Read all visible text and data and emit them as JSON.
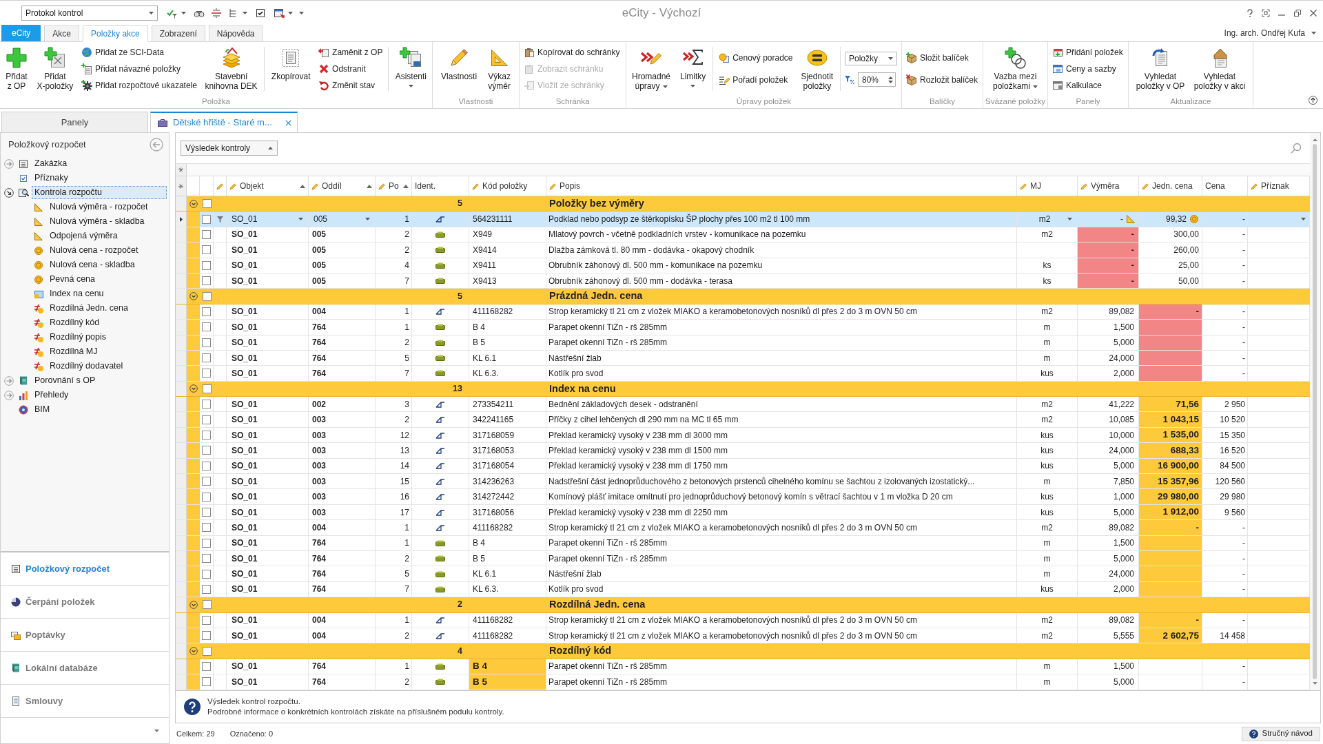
{
  "window": {
    "title": "eCity - Výchozí",
    "user": "Ing. arch. Ondřej Kufa"
  },
  "quick_access": {
    "combo": "Protokol kontrol"
  },
  "ribbon_tabs": [
    {
      "label": "eCity",
      "kind": "app",
      "selected": false
    },
    {
      "label": "Akce",
      "kind": "tab",
      "selected": false
    },
    {
      "label": "Položky akce",
      "kind": "tab",
      "selected": true
    },
    {
      "label": "Zobrazení",
      "kind": "tab",
      "selected": false
    },
    {
      "label": "Nápověda",
      "kind": "tab",
      "selected": false
    }
  ],
  "ribbon_groups": [
    {
      "label": "Položka",
      "items": [
        {
          "kind": "large",
          "label": "Přidat\nz OP",
          "dropdown": false
        },
        {
          "kind": "large",
          "label": "Přidat\nX-položky",
          "dropdown": false
        },
        {
          "kind": "stack",
          "items": [
            {
              "label": "Přidat ze SCI-Data"
            },
            {
              "label": "Přidat návazné položky"
            },
            {
              "label": "Přidat rozpočtové ukazatele"
            }
          ]
        },
        {
          "kind": "large",
          "label": "Stavební\nknihovna DEK",
          "dropdown": false
        },
        {
          "kind": "separator"
        },
        {
          "kind": "large",
          "label": "Zkopírovat",
          "dropdown": false
        },
        {
          "kind": "stack",
          "items": [
            {
              "label": "Zaměnit z OP"
            },
            {
              "label": "Odstranit"
            },
            {
              "label": "Změnit stav"
            }
          ]
        },
        {
          "kind": "separator"
        },
        {
          "kind": "large",
          "label": "Asistenti",
          "dropdown": true
        }
      ]
    },
    {
      "label": "Vlastnosti",
      "items": [
        {
          "kind": "large",
          "label": "Vlastnosti",
          "dropdown": false
        },
        {
          "kind": "large",
          "label": "Výkaz\nvýměr",
          "dropdown": false
        }
      ]
    },
    {
      "label": "Schránka",
      "items": [
        {
          "kind": "stack",
          "items": [
            {
              "label": "Kopírovat do schránky",
              "disabled": false
            },
            {
              "label": "Zobrazit schránku",
              "disabled": true
            },
            {
              "label": "Vložit ze schránky",
              "disabled": true
            }
          ]
        }
      ]
    },
    {
      "label": "Úpravy položek",
      "items": [
        {
          "kind": "large",
          "label": "Hromadné\núpravy",
          "dropdown": true
        },
        {
          "kind": "large",
          "label": "Limitky",
          "dropdown": true
        },
        {
          "kind": "separator"
        },
        {
          "kind": "stack",
          "items": [
            {
              "label": "Cenový poradce"
            },
            {
              "label": "Pořadí položek"
            }
          ]
        },
        {
          "kind": "large",
          "label": "Sjednotit\npoložky",
          "dropdown": false
        },
        {
          "kind": "separator"
        },
        {
          "kind": "controls",
          "select": "Položky",
          "zoom": "80%"
        }
      ]
    },
    {
      "label": "Balíčky",
      "items": [
        {
          "kind": "stack",
          "items": [
            {
              "label": "Složit balíček"
            },
            {
              "label": "Rozložit balíček"
            }
          ]
        }
      ]
    },
    {
      "label": "Svázané položky",
      "items": [
        {
          "kind": "large",
          "label": "Vazba mezi\npoložkami",
          "dropdown": true
        }
      ]
    },
    {
      "label": "Panely",
      "items": [
        {
          "kind": "stack",
          "items": [
            {
              "label": "Přidání položek"
            },
            {
              "label": "Ceny a sazby"
            },
            {
              "label": "Kalkulace"
            }
          ]
        }
      ]
    },
    {
      "label": "Aktualizace",
      "items": [
        {
          "kind": "large",
          "label": "Vyhledat\npoložky v OP",
          "dropdown": false
        },
        {
          "kind": "large",
          "label": "Vyhledat\npoložky v akci",
          "dropdown": false
        }
      ]
    }
  ],
  "panel_header": "Panely",
  "document_tabs": [
    {
      "label": "Dětské hřiště - Staré m...",
      "selected": true
    }
  ],
  "left_panel": {
    "title": "Položkový rozpočet",
    "tree": [
      {
        "label": "Zakázka",
        "expanded": false,
        "selected": false
      },
      {
        "label": "Příznaky",
        "selected": false
      },
      {
        "label": "Kontrola rozpočtu",
        "expanded": true,
        "selected": true,
        "children": [
          {
            "label": "Nulová výměra - rozpočet",
            "selected": false
          },
          {
            "label": "Nulová výměra - skladba",
            "selected": false
          },
          {
            "label": "Odpojená výměra",
            "selected": false
          },
          {
            "label": "Nulová cena - rozpočet",
            "selected": false
          },
          {
            "label": "Nulová cena - skladba",
            "selected": false
          },
          {
            "label": "Pevná cena",
            "selected": false
          },
          {
            "label": "Index na cenu",
            "selected": false
          },
          {
            "label": "Rozdílná Jedn. cena",
            "selected": false
          },
          {
            "label": "Rozdílný kód",
            "selected": false
          },
          {
            "label": "Rozdílný popis",
            "selected": false
          },
          {
            "label": "Rozdílná MJ",
            "selected": false
          },
          {
            "label": "Rozdílný dodavatel",
            "selected": false
          }
        ]
      },
      {
        "label": "Porovnání s OP",
        "expanded": false,
        "selected": false
      },
      {
        "label": "Přehledy",
        "expanded": false,
        "selected": false
      },
      {
        "label": "BIM",
        "selected": false
      }
    ],
    "nav": [
      {
        "label": "Položkový rozpočet",
        "selected": true
      },
      {
        "label": "Čerpání položek",
        "selected": false
      },
      {
        "label": "Poptávky",
        "selected": false
      },
      {
        "label": "Lokální databáze",
        "selected": false
      },
      {
        "label": "Smlouvy",
        "selected": false
      }
    ]
  },
  "grid": {
    "result_select": "Výsledek kontroly",
    "columns": [
      {
        "editable": true,
        "sorted": false
      },
      {
        "label": "Objekt",
        "editable": true,
        "sorted": true
      },
      {
        "label": "Oddíl",
        "editable": true,
        "sorted": true
      },
      {
        "label": "Po",
        "editable": true,
        "sorted": true
      },
      {
        "label": "Ident.",
        "editable": false,
        "sorted": false
      },
      {
        "label": "Kód položky",
        "editable": true,
        "sorted": false
      },
      {
        "label": "Popis",
        "editable": true,
        "sorted": false
      },
      {
        "label": "MJ",
        "editable": true,
        "sorted": false
      },
      {
        "label": "Výměra",
        "editable": true,
        "sorted": false
      },
      {
        "label": "Jedn. cena",
        "editable": true,
        "sorted": false
      },
      {
        "label": "Cena",
        "editable": false,
        "sorted": false
      },
      {
        "label": "Příznak",
        "editable": true,
        "sorted": false
      }
    ],
    "groups": [
      {
        "title": "Položky bez výměry",
        "count": "5",
        "color": "#f28585",
        "kind": "quantity",
        "expanded": true,
        "checked": false,
        "rows": [
          {
            "object": "SO_01",
            "section": "005",
            "order": "1",
            "kind": "work",
            "code": "564231111",
            "description": "Podklad nebo podsyp ze štěrkopísku ŠP plochy přes 100 m2 tl 100 mm",
            "unit": "m2",
            "quantity": "-",
            "unit_price": "99,32",
            "price": "-",
            "selected": true,
            "checked": false
          },
          {
            "object": "SO_01",
            "section": "005",
            "order": "2",
            "kind": "material",
            "code": "X949",
            "description": "Mlatový povrch - včetně podkladních vrstev - komunikace na pozemku",
            "unit": "m2",
            "quantity": "-",
            "unit_price": "300,00",
            "price": "-",
            "selected": false,
            "checked": false
          },
          {
            "object": "SO_01",
            "section": "005",
            "order": "2",
            "kind": "material",
            "code": "X9414",
            "description": "Dlažba zámková tl. 80 mm - dodávka - okapový chodník",
            "quantity": "-",
            "unit_price": "260,00",
            "price": "-",
            "selected": false,
            "checked": false
          },
          {
            "object": "SO_01",
            "section": "005",
            "order": "4",
            "kind": "material",
            "code": "X9411",
            "description": "Obrubník záhonový dl. 500 mm - komunikace na pozemku",
            "unit": "ks",
            "quantity": "-",
            "unit_price": "25,00",
            "price": "-",
            "selected": false,
            "checked": false
          },
          {
            "object": "SO_01",
            "section": "005",
            "order": "7",
            "kind": "material",
            "code": "X9413",
            "description": "Obrubník záhonový dl. 500 mm - dodávka - terasa",
            "unit": "ks",
            "quantity": "-",
            "unit_price": "50,00",
            "price": "-",
            "selected": false,
            "checked": false
          }
        ]
      },
      {
        "title": "Prázdná Jedn. cena",
        "count": "5",
        "color": "#f28585",
        "kind": "price",
        "expanded": true,
        "checked": false,
        "rows": [
          {
            "object": "SO_01",
            "section": "004",
            "order": "1",
            "kind": "work",
            "code": "411168282",
            "description": "Strop keramický tl 21 cm z vložek MIAKO a keramobetonových nosníků dl přes 2 do 3 m OVN 50 cm",
            "unit": "m2",
            "quantity": "89,082",
            "unit_price": "-",
            "price": "-",
            "selected": false,
            "checked": false
          },
          {
            "object": "SO_01",
            "section": "764",
            "order": "1",
            "kind": "material",
            "code": "B 4",
            "description": "Parapet okenní TiZn - rš 285mm",
            "unit": "m",
            "quantity": "1,500",
            "price": "-",
            "selected": false,
            "checked": false
          },
          {
            "object": "SO_01",
            "section": "764",
            "order": "2",
            "kind": "material",
            "code": "B 5",
            "description": "Parapet okenní TiZn - rš 285mm",
            "unit": "m",
            "quantity": "5,000",
            "price": "-",
            "selected": false,
            "checked": false
          },
          {
            "object": "SO_01",
            "section": "764",
            "order": "5",
            "kind": "material",
            "code": "KL 6.1",
            "description": "Nástřešní žlab",
            "unit": "m",
            "quantity": "24,000",
            "price": "-",
            "selected": false,
            "checked": false
          },
          {
            "object": "SO_01",
            "section": "764",
            "order": "7",
            "kind": "material",
            "code": "KL 6.3.",
            "description": "Kotlík pro svod",
            "unit": "kus",
            "quantity": "2,000",
            "price": "-",
            "selected": false,
            "checked": false
          }
        ]
      },
      {
        "title": "Index na cenu",
        "count": "13",
        "color": "#ffc93c",
        "kind": "price",
        "expanded": true,
        "checked": false,
        "rows": [
          {
            "object": "SO_01",
            "section": "002",
            "order": "3",
            "kind": "work",
            "code": "273354211",
            "description": "Bednění základových desek - odstranění",
            "unit": "m2",
            "quantity": "41,222",
            "unit_price": "71,56",
            "price": "2 950",
            "selected": false,
            "checked": false
          },
          {
            "object": "SO_01",
            "section": "003",
            "order": "2",
            "kind": "work",
            "code": "342241165",
            "description": "Příčky z cihel lehčených dl 290 mm na MC tl 65 mm",
            "unit": "m2",
            "quantity": "10,085",
            "unit_price": "1 043,15",
            "price": "10 520",
            "selected": false,
            "checked": false
          },
          {
            "object": "SO_01",
            "section": "003",
            "order": "12",
            "kind": "work",
            "code": "317168059",
            "description": "Překlad keramický vysoký v 238 mm dl 3000 mm",
            "unit": "kus",
            "quantity": "10,000",
            "unit_price": "1 535,00",
            "price": "15 350",
            "selected": false,
            "checked": false
          },
          {
            "object": "SO_01",
            "section": "003",
            "order": "13",
            "kind": "work",
            "code": "317168053",
            "description": "Překlad keramický vysoký v 238 mm dl 1500 mm",
            "unit": "kus",
            "quantity": "24,000",
            "unit_price": "688,33",
            "price": "16 520",
            "selected": false,
            "checked": false
          },
          {
            "object": "SO_01",
            "section": "003",
            "order": "14",
            "kind": "work",
            "code": "317168054",
            "description": "Překlad keramický vysoký v 238 mm dl 1750 mm",
            "unit": "kus",
            "quantity": "5,000",
            "unit_price": "16 900,00",
            "price": "84 500",
            "selected": false,
            "checked": false
          },
          {
            "object": "SO_01",
            "section": "003",
            "order": "15",
            "kind": "work",
            "code": "314236263",
            "description": "Nadstřešní část jednoprůduchového z betonových prstenců cihelného komínu se šachtou z izolovaných izostatický...",
            "unit": "m",
            "quantity": "7,850",
            "unit_price": "15 357,96",
            "price": "120 560",
            "selected": false,
            "checked": false
          },
          {
            "object": "SO_01",
            "section": "003",
            "order": "16",
            "kind": "work",
            "code": "314272442",
            "description": "Komínový plášť imitace omítnutí pro jednoprůduchový betonový komín s větrací šachtou v 1 m vložka D 20 cm",
            "unit": "kus",
            "quantity": "1,000",
            "unit_price": "29 980,00",
            "price": "29 980",
            "selected": false,
            "checked": false
          },
          {
            "object": "SO_01",
            "section": "003",
            "order": "17",
            "kind": "work",
            "code": "317168056",
            "description": "Překlad keramický vysoký v 238 mm dl 2250 mm",
            "unit": "kus",
            "quantity": "5,000",
            "unit_price": "1 912,00",
            "price": "9 560",
            "selected": false,
            "checked": false
          },
          {
            "object": "SO_01",
            "section": "004",
            "order": "1",
            "kind": "work",
            "code": "411168282",
            "description": "Strop keramický tl 21 cm z vložek MIAKO a keramobetonových nosníků dl přes 2 do 3 m OVN 50 cm",
            "unit": "m2",
            "quantity": "89,082",
            "unit_price": "-",
            "price": "-",
            "selected": false,
            "checked": false
          },
          {
            "object": "SO_01",
            "section": "764",
            "order": "1",
            "kind": "material",
            "code": "B 4",
            "description": "Parapet okenní TiZn - rš 285mm",
            "unit": "m",
            "quantity": "1,500",
            "price": "-",
            "selected": false,
            "checked": false
          },
          {
            "object": "SO_01",
            "section": "764",
            "order": "2",
            "kind": "material",
            "code": "B 5",
            "description": "Parapet okenní TiZn - rš 285mm",
            "unit": "m",
            "quantity": "5,000",
            "price": "-",
            "selected": false,
            "checked": false
          },
          {
            "object": "SO_01",
            "section": "764",
            "order": "5",
            "kind": "material",
            "code": "KL 6.1",
            "description": "Nástřešní žlab",
            "unit": "m",
            "quantity": "24,000",
            "price": "-",
            "selected": false,
            "checked": false
          },
          {
            "object": "SO_01",
            "section": "764",
            "order": "7",
            "kind": "material",
            "code": "KL 6.3.",
            "description": "Kotlík pro svod",
            "unit": "kus",
            "quantity": "2,000",
            "price": "-",
            "selected": false,
            "checked": false
          }
        ]
      },
      {
        "title": "Rozdílná Jedn. cena",
        "count": "2",
        "color": "#ffc93c",
        "kind": "price",
        "expanded": true,
        "checked": false,
        "rows": [
          {
            "object": "SO_01",
            "section": "004",
            "order": "1",
            "kind": "work",
            "code": "411168282",
            "description": "Strop keramický tl 21 cm z vložek MIAKO a keramobetonových nosníků dl přes 2 do 3 m OVN 50 cm",
            "unit": "m2",
            "quantity": "89,082",
            "unit_price": "-",
            "price": "-",
            "selected": false,
            "checked": false
          },
          {
            "object": "SO_01",
            "section": "004",
            "order": "2",
            "kind": "work",
            "code": "411168282",
            "description": "Strop keramický tl 21 cm z vložek MIAKO a keramobetonových nosníků dl přes 2 do 3 m OVN 50 cm",
            "unit": "m2",
            "quantity": "5,555",
            "unit_price": "2 602,75",
            "price": "14 458",
            "selected": false,
            "checked": false
          }
        ]
      },
      {
        "title": "Rozdílný kód",
        "count": "4",
        "color": "#ffc93c",
        "kind": "code",
        "expanded": true,
        "checked": false,
        "rows": [
          {
            "object": "SO_01",
            "section": "764",
            "order": "1",
            "kind": "material",
            "code": "B 4",
            "description": "Parapet okenní TiZn - rš 285mm",
            "unit": "m",
            "quantity": "1,500",
            "price": "-",
            "selected": false,
            "checked": false
          },
          {
            "object": "SO_01",
            "section": "764",
            "order": "2",
            "kind": "material",
            "code": "B 5",
            "description": "Parapet okenní TiZn - rš 285mm",
            "unit": "m",
            "quantity": "5,000",
            "price": "-",
            "selected": false,
            "checked": false
          }
        ]
      }
    ]
  },
  "info": {
    "lines": [
      "Výsledek kontrol rozpočtu.",
      "Podrobné informace o konkrétních kontrolách získáte na příslušném podulu kontroly."
    ]
  },
  "status": {
    "total": "Celkem: 29",
    "marked": "Označeno: 0",
    "help_button": "Stručný návod"
  }
}
